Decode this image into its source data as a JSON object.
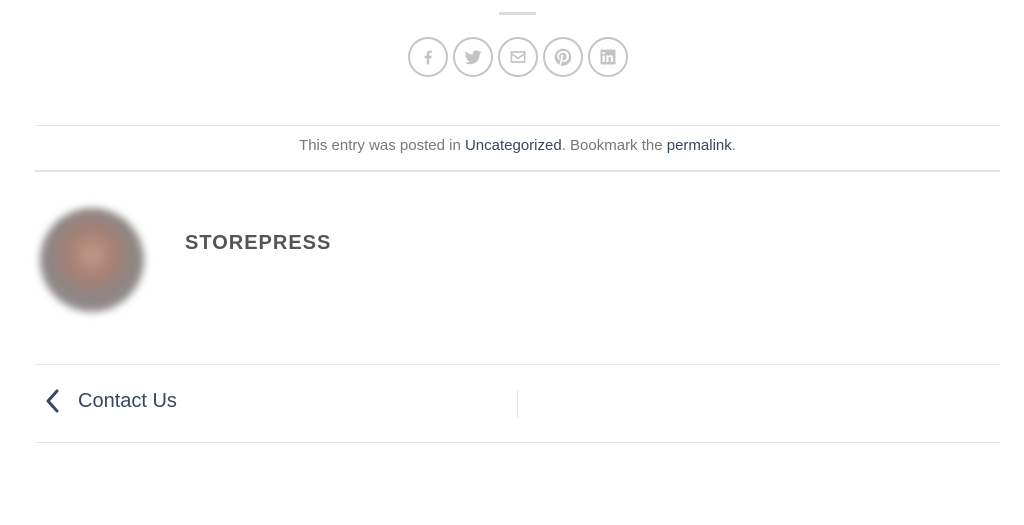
{
  "share": {
    "buttons": [
      {
        "icon": "facebook-icon"
      },
      {
        "icon": "twitter-icon"
      },
      {
        "icon": "email-icon"
      },
      {
        "icon": "pinterest-icon"
      },
      {
        "icon": "linkedin-icon"
      }
    ]
  },
  "entry_meta": {
    "prefix": "This entry was posted in ",
    "category": "Uncategorized",
    "middle": ". Bookmark the ",
    "permalink": "permalink",
    "suffix": "."
  },
  "author": {
    "name": "STOREPRESS"
  },
  "post_nav": {
    "previous_label": "Contact Us"
  },
  "colors": {
    "link": "#334862",
    "text": "#777777",
    "icon": "#c4c4c4"
  }
}
